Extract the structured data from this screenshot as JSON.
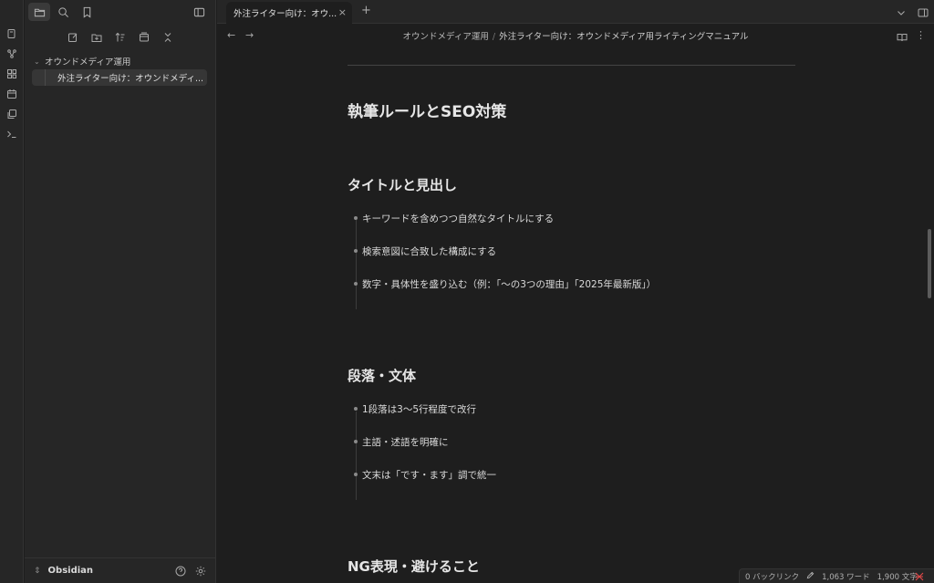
{
  "app": {
    "name": "Obsidian"
  },
  "tab": {
    "title": "外注ライター向け：オウ...",
    "close": "×",
    "new": "+"
  },
  "nav": {
    "back": "←",
    "forward": "→",
    "more": "⋮"
  },
  "breadcrumb": {
    "folder": "オウンドメディア運用",
    "sep": "/",
    "note": "外注ライター向け：オウンドメディア用ライティングマニュアル"
  },
  "sidebar": {
    "folder": "オウンドメディア運用",
    "file": "外注ライター向け：オウンドメディ...",
    "vault_name": "Obsidian"
  },
  "doc": {
    "h2": "執筆ルールとSEO対策",
    "sections": [
      {
        "title": "タイトルと見出し",
        "items": [
          "キーワードを含めつつ自然なタイトルにする",
          "検索意図に合致した構成にする",
          "数字・具体性を盛り込む（例：「〜の3つの理由」「2025年最新版」）"
        ]
      },
      {
        "title": "段落・文体",
        "items": [
          "1段落は3〜5行程度で改行",
          "主語・述語を明確に",
          "文末は「です・ます」調で統一"
        ]
      },
      {
        "title": "NG表現・避けること",
        "items": []
      }
    ]
  },
  "status": {
    "backlinks": "0 バックリンク",
    "words": "1,063 ワード",
    "chars": "1,900 文字"
  }
}
